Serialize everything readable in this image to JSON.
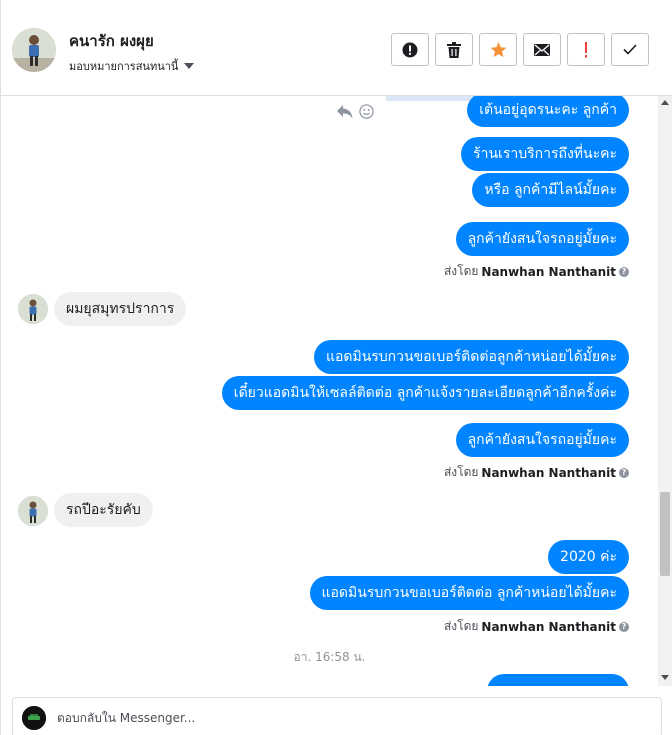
{
  "header": {
    "contact_name": "คนารัก ผงผุย",
    "assign_label": "มอบหมายการสนทนานี้"
  },
  "actions": [
    {
      "name": "report-button",
      "icon": "alert-circle-icon"
    },
    {
      "name": "delete-button",
      "icon": "trash-icon"
    },
    {
      "name": "star-button",
      "icon": "star-icon",
      "color": "#f7923b"
    },
    {
      "name": "mark-unread-button",
      "icon": "envelope-icon"
    },
    {
      "name": "follow-up-button",
      "icon": "exclamation-icon",
      "color": "#fa3e3e"
    },
    {
      "name": "mark-done-button",
      "icon": "check-icon"
    }
  ],
  "messages": {
    "out1": "เต้นอยู่อุดรนะคะ ลูกค้า",
    "out2": "ร้านเราบริการถึงที่นะคะ",
    "out3": "หรือ ลูกค้ามีไลน์มั้ยคะ",
    "out4": "ลูกค้ายังสนใจรถอยู่มั้ยคะ",
    "in1": "ผมยุสมุทรปราการ",
    "out5": "แอดมินรบกวนขอเบอร์ติดต่อลูกค้าหน่อยได้มั้ยคะ",
    "out6": "เดี๋ยวแอดมินให้เซลล์ติดต่อ ลูกค้าแจ้งรายละเอียดลูกค้าอีกครั้งค่ะ",
    "out7": "ลูกค้ายังสนใจรถอยู่มั้ยคะ",
    "in2": "รถปีอะรัยคับ",
    "out8": "2020 ค่ะ",
    "out9": "แอดมินรบกวนขอเบอร์ติดต่อ ลูกค้าหน่อยได้มั้ยคะ"
  },
  "sent_by": {
    "prefix": "ส่งโดย",
    "name": "Nanwhan Nanthanit"
  },
  "timestamp": "อา. 16:58 น.",
  "composer": {
    "placeholder": "ตอบกลับใน Messenger..."
  },
  "colors": {
    "outgoing_bubble": "#0084ff",
    "incoming_bubble": "#f1f0f0",
    "star": "#f7923b",
    "flag": "#fa3e3e"
  }
}
